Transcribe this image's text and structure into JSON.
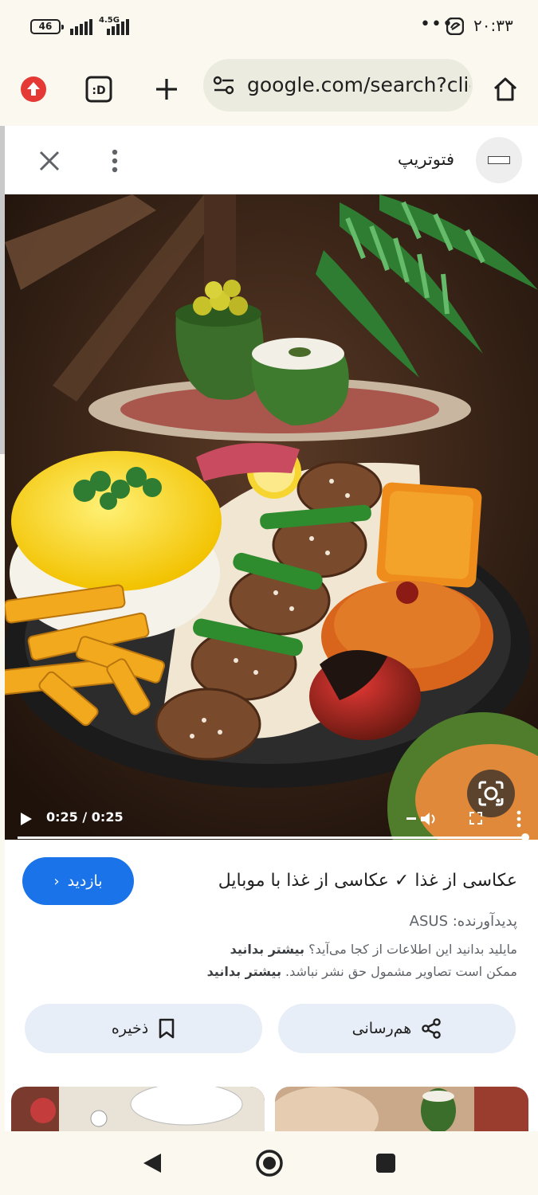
{
  "status_bar": {
    "battery": "46",
    "network": "4.5G",
    "time": "۲۰:۳۳",
    "more": "•••"
  },
  "browser": {
    "url": "google.com/search?client",
    "tabs_label": ":D"
  },
  "panel": {
    "source_name": "فتوتریپ"
  },
  "video": {
    "time": "0:25 / 0:25",
    "progress_percent": 100
  },
  "result": {
    "title": "عکاسی از غذا ✓ عکاسی از غذا با موبایل",
    "visit_label": "بازدید",
    "creator_prefix": "پدیدآورنده: ",
    "creator": "ASUS",
    "info_text": "مایلید بدانید این اطلاعات از کجا می‌آید؟",
    "info_link": "بیشتر بدانید",
    "copyright_text": "ممکن است تصاویر مشمول حق نشر نباشد.",
    "copyright_link": "بیشتر بدانید",
    "share_label": "هم‌رسانی",
    "save_label": "ذخیره"
  },
  "colors": {
    "accent": "#1a73e8",
    "surface": "#fbf8ef",
    "pill": "#e8eef8",
    "update_red": "#e53935"
  }
}
